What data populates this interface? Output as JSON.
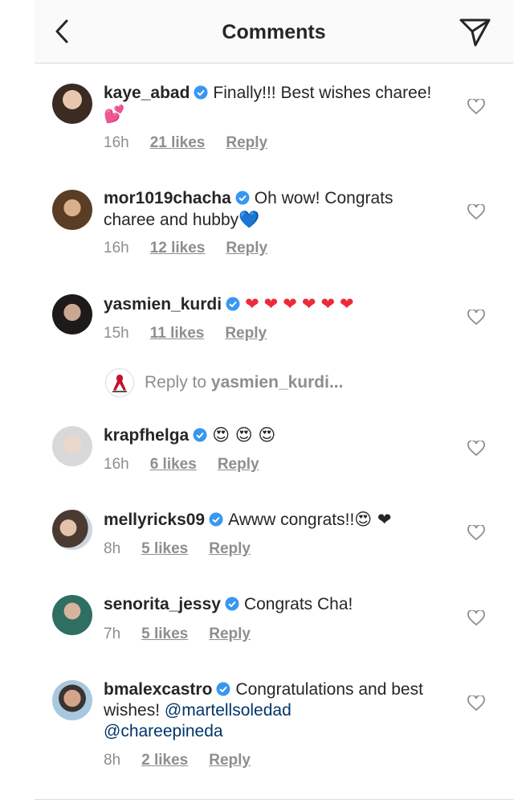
{
  "header": {
    "title": "Comments"
  },
  "comments": [
    {
      "username": "kaye_abad",
      "text": "Finally!!! Best wishes charee!",
      "emoji": "💕",
      "time": "16h",
      "likes": "21 likes",
      "reply": "Reply"
    },
    {
      "username": "mor1019chacha",
      "text": "Oh wow! Congrats charee and hubby",
      "emoji": "💙",
      "time": "16h",
      "likes": "12 likes",
      "reply": "Reply"
    },
    {
      "username": "yasmien_kurdi",
      "text": "",
      "emoji": "❤❤❤❤❤❤",
      "time": "15h",
      "likes": "11 likes",
      "reply": "Reply"
    },
    {
      "username": "krapfhelga",
      "text": "",
      "emoji": "😍 😍 😍",
      "time": "16h",
      "likes": "6 likes",
      "reply": "Reply"
    },
    {
      "username": "mellyricks09",
      "text": "Awww congrats!!",
      "emoji": "😍 ❤",
      "time": "8h",
      "likes": "5 likes",
      "reply": "Reply"
    },
    {
      "username": "senorita_jessy",
      "text": "Congrats Cha!",
      "emoji": "",
      "time": "7h",
      "likes": "5 likes",
      "reply": "Reply"
    },
    {
      "username": "bmalexcastro",
      "text": "Congratulations and best wishes!",
      "mention1": "@martellsoledad",
      "mention2": "@chareepineda",
      "time": "8h",
      "likes": "2 likes",
      "reply": "Reply"
    }
  ],
  "reply_box": {
    "prefix": "Reply to",
    "target": "yasmien_kurdi..."
  },
  "colors": {
    "verified": "#3897f0",
    "mention": "#003569",
    "meta": "#8e8e8e",
    "heart_red": "#ed2a3b"
  }
}
